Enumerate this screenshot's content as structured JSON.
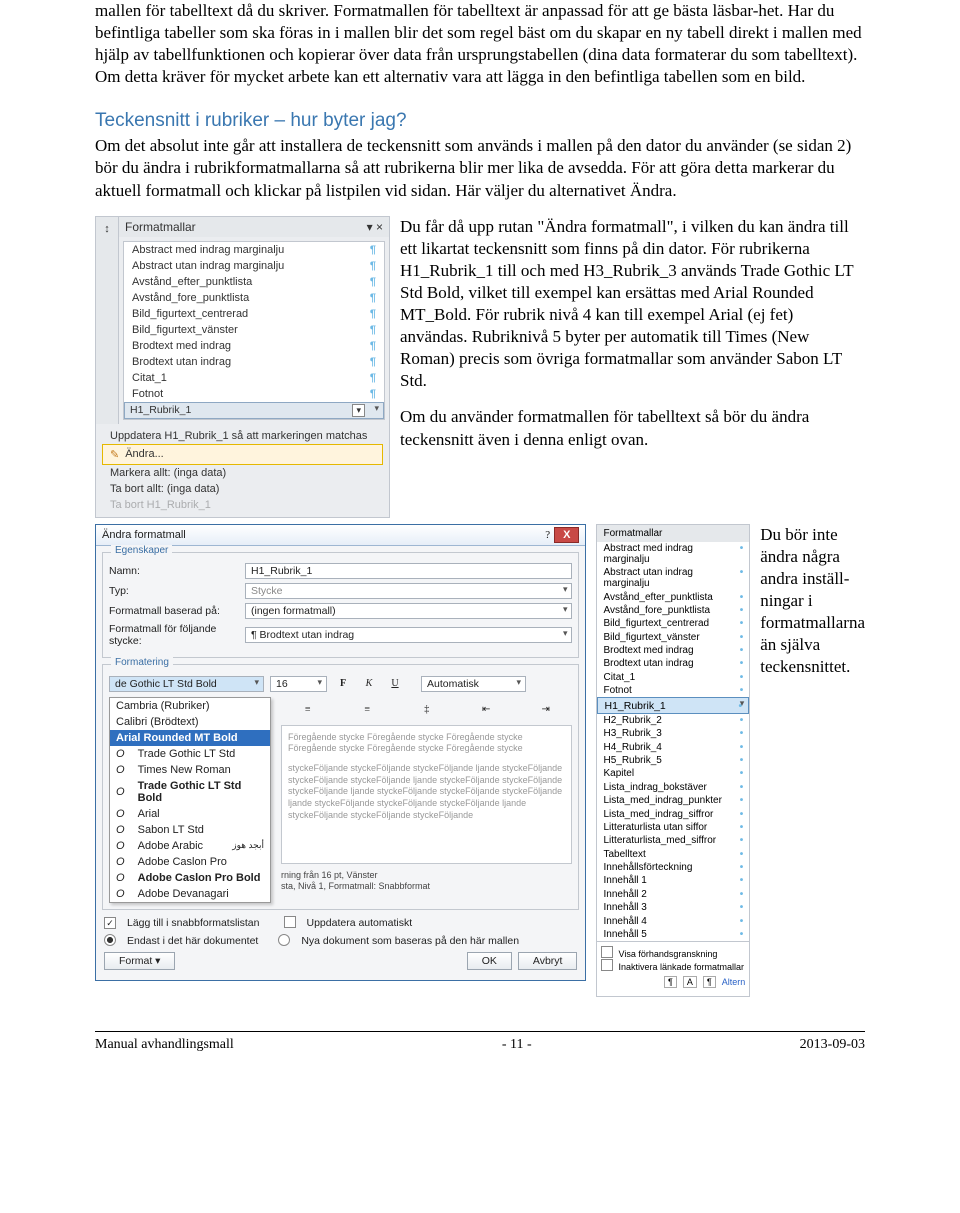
{
  "body": {
    "p1": "mallen för tabelltext då du skriver. Formatmallen för tabelltext är anpassad för att ge bästa läsbar-het. Har du befintliga tabeller som ska föras in i mallen blir det som regel bäst om du skapar en ny tabell direkt i mallen med hjälp av tabellfunktionen och kopierar över data från ursprungstabellen (dina data formaterar du som tabelltext). Om detta kräver för mycket arbete kan ett alternativ vara att lägga in den befintliga tabellen som en bild.",
    "h1": "Teckensnitt i rubriker – hur byter jag?",
    "p2": "Om det absolut inte går att installera de teckensnitt som används i mallen på den dator du använder (se sidan 2) bör du ändra i rubrikformatmallarna så att rubrikerna blir mer lika de avsedda. För att göra detta markerar du aktuell formatmall och klickar på listpilen vid sidan. Här väljer du alternativet Ändra.",
    "p3_a": "Du får då upp rutan \"Ändra formatmall\", i vilken du kan ändra till ett likartat teckensnitt som finns på din dator. För rubrikerna H1_Rubrik_1 till och med H3_Rubrik_3 används Trade Gothic LT Std Bold, vilket till exempel kan ersättas med Arial Rounded MT_Bold. För rubrik nivå 4 kan till exempel Arial (ej fet) användas. Rubriknivå 5 byter per automatik till Times (New Roman) precis som övriga formatmallar som använder Sabon LT Std.",
    "p3_b": "Om du använder formatmallen för tabelltext så bör du ändra teckensnitt även i denna enligt ovan.",
    "p4": "Du bör inte ändra några andra inställ-ningar i formatmallarna än själva teckensnittet."
  },
  "panel": {
    "title": "Formatmallar",
    "items": [
      "Abstract med indrag marginalju",
      "Abstract utan indrag marginalju",
      "Avstånd_efter_punktlista",
      "Avstånd_fore_punktlista",
      "Bild_figurtext_centrerad",
      "Bild_figurtext_vänster",
      "Brodtext med indrag",
      "Brodtext utan indrag",
      "Citat_1",
      "Fotnot"
    ],
    "items_sel": "H1_Rubrik_1",
    "ctx_update": "Uppdatera H1_Rubrik_1 så att markeringen matchas",
    "ctx_edit": "Ändra...",
    "ctx_markall": "Markera allt: (inga data)",
    "ctx_rmall": "Ta bort allt: (inga data)",
    "ctx_del": "Ta bort H1_Rubrik_1"
  },
  "dlg": {
    "title": "Ändra formatmall",
    "grp1": "Egenskaper",
    "l_name": "Namn:",
    "v_name": "H1_Rubrik_1",
    "l_type": "Typ:",
    "v_type": "Stycke",
    "l_based": "Formatmall baserad på:",
    "v_based": "(ingen formatmall)",
    "l_follow": "Formatmall för följande stycke:",
    "v_follow": "¶ Brodtext utan indrag",
    "grp2": "Formatering",
    "font_cur": "de Gothic LT Std Bold",
    "font_size": "16",
    "auto": "Automatisk",
    "fonts": {
      "cambria": "Cambria (Rubriker)",
      "calibri": "Calibri (Brödtext)",
      "arb": "Arial Rounded MT Bold",
      "tg": "Trade Gothic LT Std",
      "tnr": "Times New Roman",
      "tgb": "Trade Gothic LT Std Bold",
      "arial": "Arial",
      "sabon": "Sabon LT Std",
      "aa": "Adobe Arabic",
      "acp": "Adobe Caslon Pro",
      "acpb": "Adobe Caslon Pro Bold",
      "ad": "Adobe Devanagari"
    },
    "preview_fg": "Föregående stycke Föregående stycke Föregående stycke Föregående stycke Föregående stycke Föregående stycke",
    "preview_fj": "styckeFöljande styckeFöljande styckeFöljande ljande styckeFöljande styckeFöljande styckeFöljande ljande styckeFöljande styckeFöljande styckeFöljande ljande styckeFöljande styckeFöljande styckeFöljande ljande styckeFöljande styckeFöljande styckeFöljande ljande styckeFöljande styckeFöljande styckeFöljande",
    "rule1": "rning från 16 pt, Vänster",
    "rule2": "sta, Nivå 1, Formatmall: Snabbformat",
    "chk_quick": "Lägg till i snabbformatslistan",
    "chk_auto": "Uppdatera automatiskt",
    "rad_doc": "Endast i det här dokumentet",
    "rad_tpl": "Nya dokument som baseras på den här mallen",
    "btn_format": "Format ▾",
    "btn_ok": "OK",
    "btn_cancel": "Avbryt"
  },
  "panel2": {
    "title": "Formatmallar",
    "items": [
      "Abstract med indrag marginalju",
      "Abstract utan indrag marginalju",
      "Avstånd_efter_punktlista",
      "Avstånd_fore_punktlista",
      "Bild_figurtext_centrerad",
      "Bild_figurtext_vänster",
      "Brodtext med indrag",
      "Brodtext utan indrag",
      "Citat_1",
      "Fotnot",
      "H1_Rubrik_1",
      "H2_Rubrik_2",
      "H3_Rubrik_3",
      "H4_Rubrik_4",
      "H5_Rubrik_5",
      "Kapitel",
      "Lista_indrag_bokstäver",
      "Lista_med_indrag_punkter",
      "Lista_med_indrag_siffror",
      "Litteraturlista utan siffor",
      "Litteraturlista_med_siffror",
      "Tabelltext",
      "Innehållsförteckning",
      "Innehåll 1",
      "Innehåll 2",
      "Innehåll 3",
      "Innehåll 4",
      "Innehåll 5"
    ],
    "sel_idx": 10,
    "chk_preview": "Visa förhandsgranskning",
    "chk_inact": "Inaktivera länkade formatmallar",
    "altern": "Altern"
  },
  "footer": {
    "left": "Manual avhandlingsmall",
    "mid": "- 11 -",
    "right": "2013-09-03"
  }
}
